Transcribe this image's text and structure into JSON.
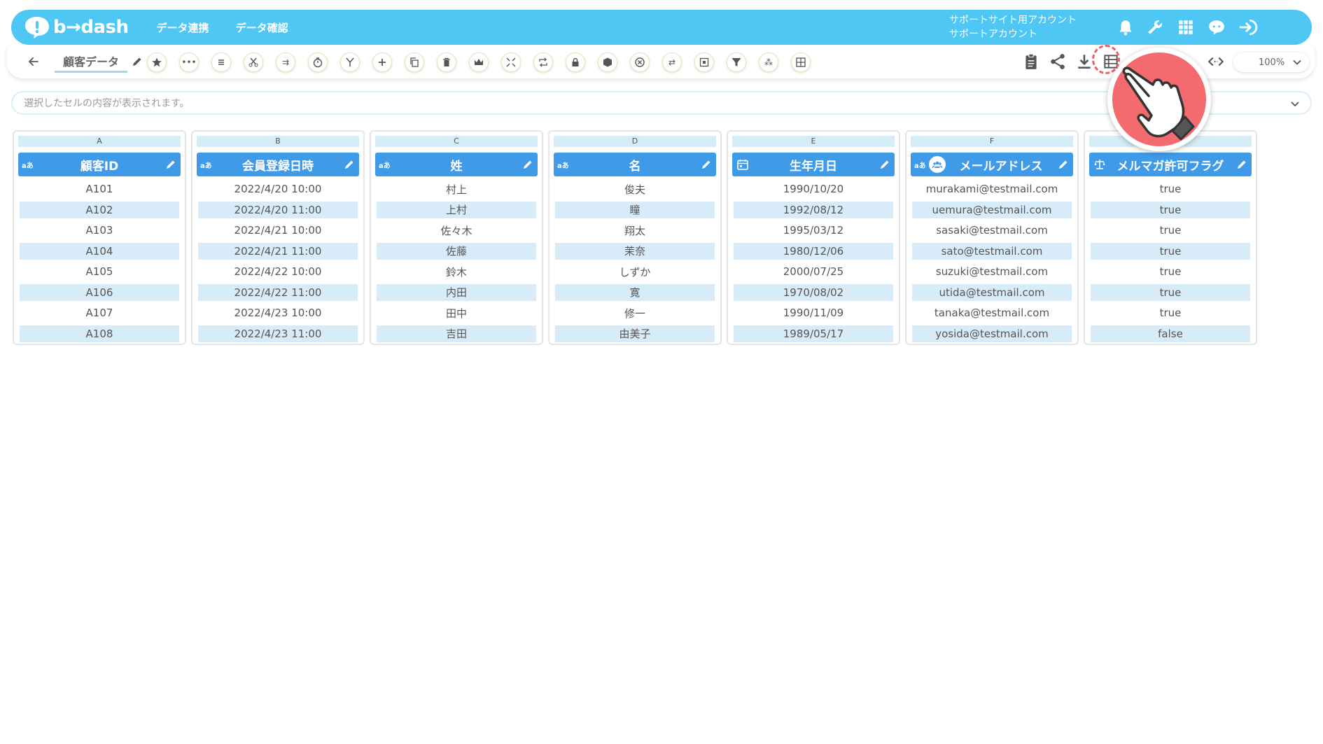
{
  "header": {
    "logo_text": "b→dash",
    "nav": [
      "データ連携",
      "データ確認"
    ],
    "account_line1": "サポートサイト用アカウント",
    "account_line2": "サポートアカウント",
    "icons": [
      "bell-icon",
      "wrench-icon",
      "apps-grid-icon",
      "chat-icon",
      "logout-icon"
    ]
  },
  "toolbar": {
    "sheet_name": "顧客データ",
    "zoom": "100%",
    "tools": [
      "star-icon",
      "more-icon",
      "list-icon",
      "scissors-icon",
      "move-x-icon",
      "timer-icon",
      "merge-icon",
      "add-icon",
      "copy-icon",
      "trash-icon",
      "crown-icon",
      "compress-icon",
      "repeat-icon",
      "lock-icon",
      "box-icon",
      "cancel-icon",
      "swap-icon",
      "frame-icon",
      "filter-icon",
      "pivot-icon",
      "grid-icon"
    ],
    "right_tools": [
      "clipboard-icon",
      "share-icon",
      "download-icon",
      "table-view-icon",
      "code-icon"
    ]
  },
  "formula_bar": {
    "placeholder": "選択したセルの内容が表示されます。"
  },
  "colors": {
    "header_bg": "#4fc7f5",
    "column_header_bg": "#3f9ae8",
    "alt_row_bg": "#d7ebf8",
    "highlight": "#f36a6f"
  },
  "columns": [
    {
      "letter": "A",
      "title": "顧客ID",
      "type": "text",
      "cells": [
        "A101",
        "A102",
        "A103",
        "A104",
        "A105",
        "A106",
        "A107",
        "A108"
      ]
    },
    {
      "letter": "B",
      "title": "会員登録日時",
      "type": "text",
      "cells": [
        "2022/4/20 10:00",
        "2022/4/20 11:00",
        "2022/4/21 10:00",
        "2022/4/21 11:00",
        "2022/4/22 10:00",
        "2022/4/22 11:00",
        "2022/4/23 10:00",
        "2022/4/23 11:00"
      ]
    },
    {
      "letter": "C",
      "title": "姓",
      "type": "text",
      "cells": [
        "村上",
        "上村",
        "佐々木",
        "佐藤",
        "鈴木",
        "内田",
        "田中",
        "吉田"
      ]
    },
    {
      "letter": "D",
      "title": "名",
      "type": "text",
      "cells": [
        "俊夫",
        "瞳",
        "翔太",
        "茉奈",
        "しずか",
        "寛",
        "修一",
        "由美子"
      ]
    },
    {
      "letter": "E",
      "title": "生年月日",
      "type": "date",
      "cells": [
        "1990/10/20",
        "1992/08/12",
        "1995/03/12",
        "1980/12/06",
        "2000/07/25",
        "1970/08/02",
        "1990/11/09",
        "1989/05/17"
      ]
    },
    {
      "letter": "F",
      "title": "メールアドレス",
      "type": "text",
      "cells": [
        "murakami@testmail.com",
        "uemura@testmail.com",
        "sasaki@testmail.com",
        "sato@testmail.com",
        "suzuki@testmail.com",
        "utida@testmail.com",
        "tanaka@testmail.com",
        "yosida@testmail.com"
      ]
    },
    {
      "letter": "",
      "title": "メルマガ許可フラグ",
      "type": "boolean",
      "cells": [
        "true",
        "true",
        "true",
        "true",
        "true",
        "true",
        "true",
        "false"
      ]
    }
  ]
}
